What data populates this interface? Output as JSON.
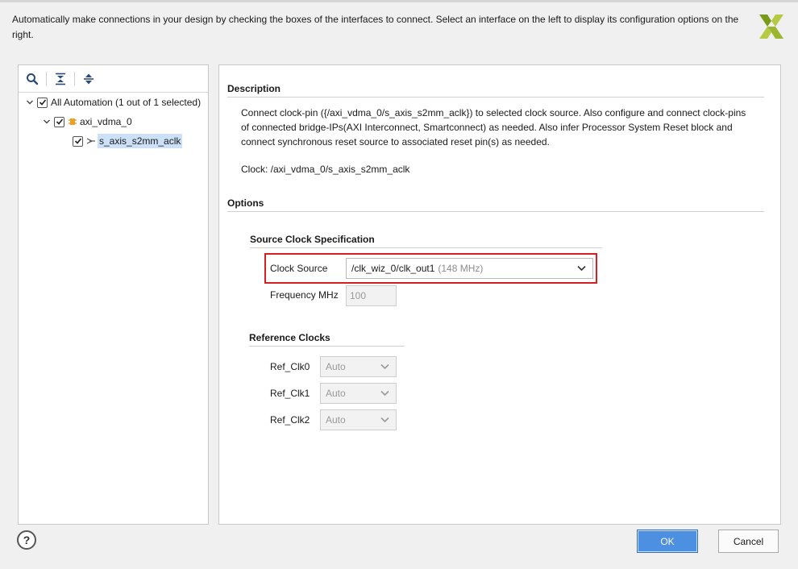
{
  "instructions": "Automatically make connections in your design by checking the boxes of the interfaces to connect. Select an interface on the left to display its configuration options on the right.",
  "logo": "xilinx-logo",
  "tree": {
    "toolbar": [
      "search-icon",
      "collapse-all-icon",
      "expand-all-icon"
    ],
    "root": {
      "label": "All Automation (1 out of 1 selected)",
      "checked": true
    },
    "child": {
      "label": "axi_vdma_0",
      "checked": true,
      "icon": "ip-block-icon"
    },
    "leaf": {
      "label": "s_axis_s2mm_aclk",
      "checked": true,
      "icon": "clock-pin-icon",
      "selected": true
    }
  },
  "description": {
    "heading": "Description",
    "text": "Connect clock-pin ({/axi_vdma_0/s_axis_s2mm_aclk}) to selected clock source. Also configure and connect clock-pins of connected bridge-IPs(AXI Interconnect, Smartconnect) as needed. Also infer Processor System Reset block and connect synchronous reset source to associated reset pin(s) as needed.",
    "clock_line": "Clock: /axi_vdma_0/s_axis_s2mm_aclk"
  },
  "options": {
    "heading": "Options",
    "source_clock": {
      "heading": "Source Clock Specification",
      "clock_source_label": "Clock Source",
      "clock_source_value": "/clk_wiz_0/clk_out1",
      "clock_source_freq": "(148 MHz)",
      "frequency_label": "Frequency MHz",
      "frequency_value": "100"
    },
    "reference_clocks": {
      "heading": "Reference Clocks",
      "items": [
        {
          "label": "Ref_Clk0",
          "value": "Auto"
        },
        {
          "label": "Ref_Clk1",
          "value": "Auto"
        },
        {
          "label": "Ref_Clk2",
          "value": "Auto"
        }
      ]
    }
  },
  "footer": {
    "help": "?",
    "ok": "OK",
    "cancel": "Cancel"
  },
  "colors": {
    "highlight": "#d42020",
    "ok_button": "#4d8fe0",
    "selection": "#cce0f7"
  }
}
